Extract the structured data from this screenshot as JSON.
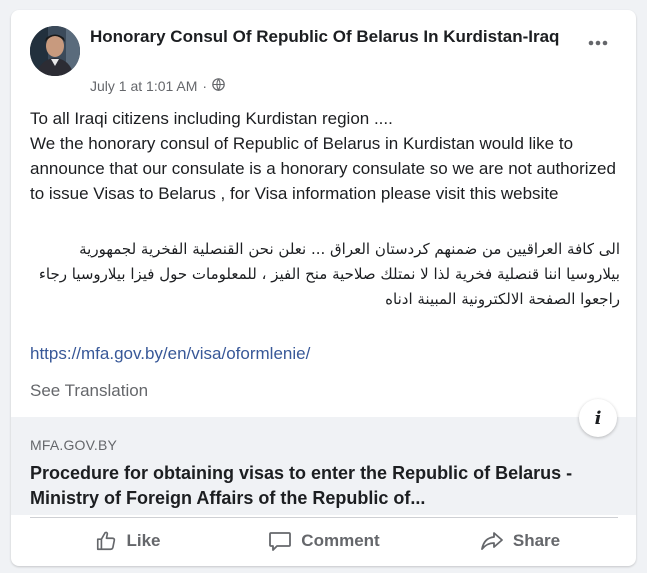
{
  "post": {
    "author": "Honorary Consul Of Republic Of Belarus In Kurdistan-Iraq",
    "timestamp": "July 1 at 1:01 AM",
    "meta_separator": "·",
    "privacy_icon": "globe-icon",
    "more_icon": "ellipsis-icon",
    "text_lines": [
      "To all Iraqi citizens including Kurdistan region ....",
      "We the honorary consul of Republic of Belarus in Kurdistan would like to announce that our consulate is a honorary consulate so we are not authorized to issue Visas to Belarus , for Visa information please visit this website"
    ],
    "arabic_text": "الى كافة العراقيين من ضمنهم كردستان العراق ... نعلن نحن القنصلية الفخرية لجمهورية بيلاروسيا اننا قنصلية فخرية لذا لا نمتلك صلاحية منح الفيز ، للمعلومات حول فيزا بيلاروسيا رجاء راجعوا الصفحة الالكترونية المبينة ادناه",
    "link": "https://mfa.gov.by/en/visa/oformlenie/",
    "see_translation": "See Translation"
  },
  "preview": {
    "domain": "MFA.GOV.BY",
    "title": "Procedure for obtaining visas to enter the Republic of Belarus - Ministry of Foreign Affairs of the Republic of...",
    "info_icon": "info-icon",
    "info_label": "i"
  },
  "actions": [
    {
      "label": "Like",
      "icon": "thumbs-up-icon"
    },
    {
      "label": "Comment",
      "icon": "comment-icon"
    },
    {
      "label": "Share",
      "icon": "share-icon"
    }
  ],
  "colors": {
    "background": "#f0f2f5",
    "text": "#1c1e21",
    "secondary": "#65676b",
    "link": "#385898"
  }
}
